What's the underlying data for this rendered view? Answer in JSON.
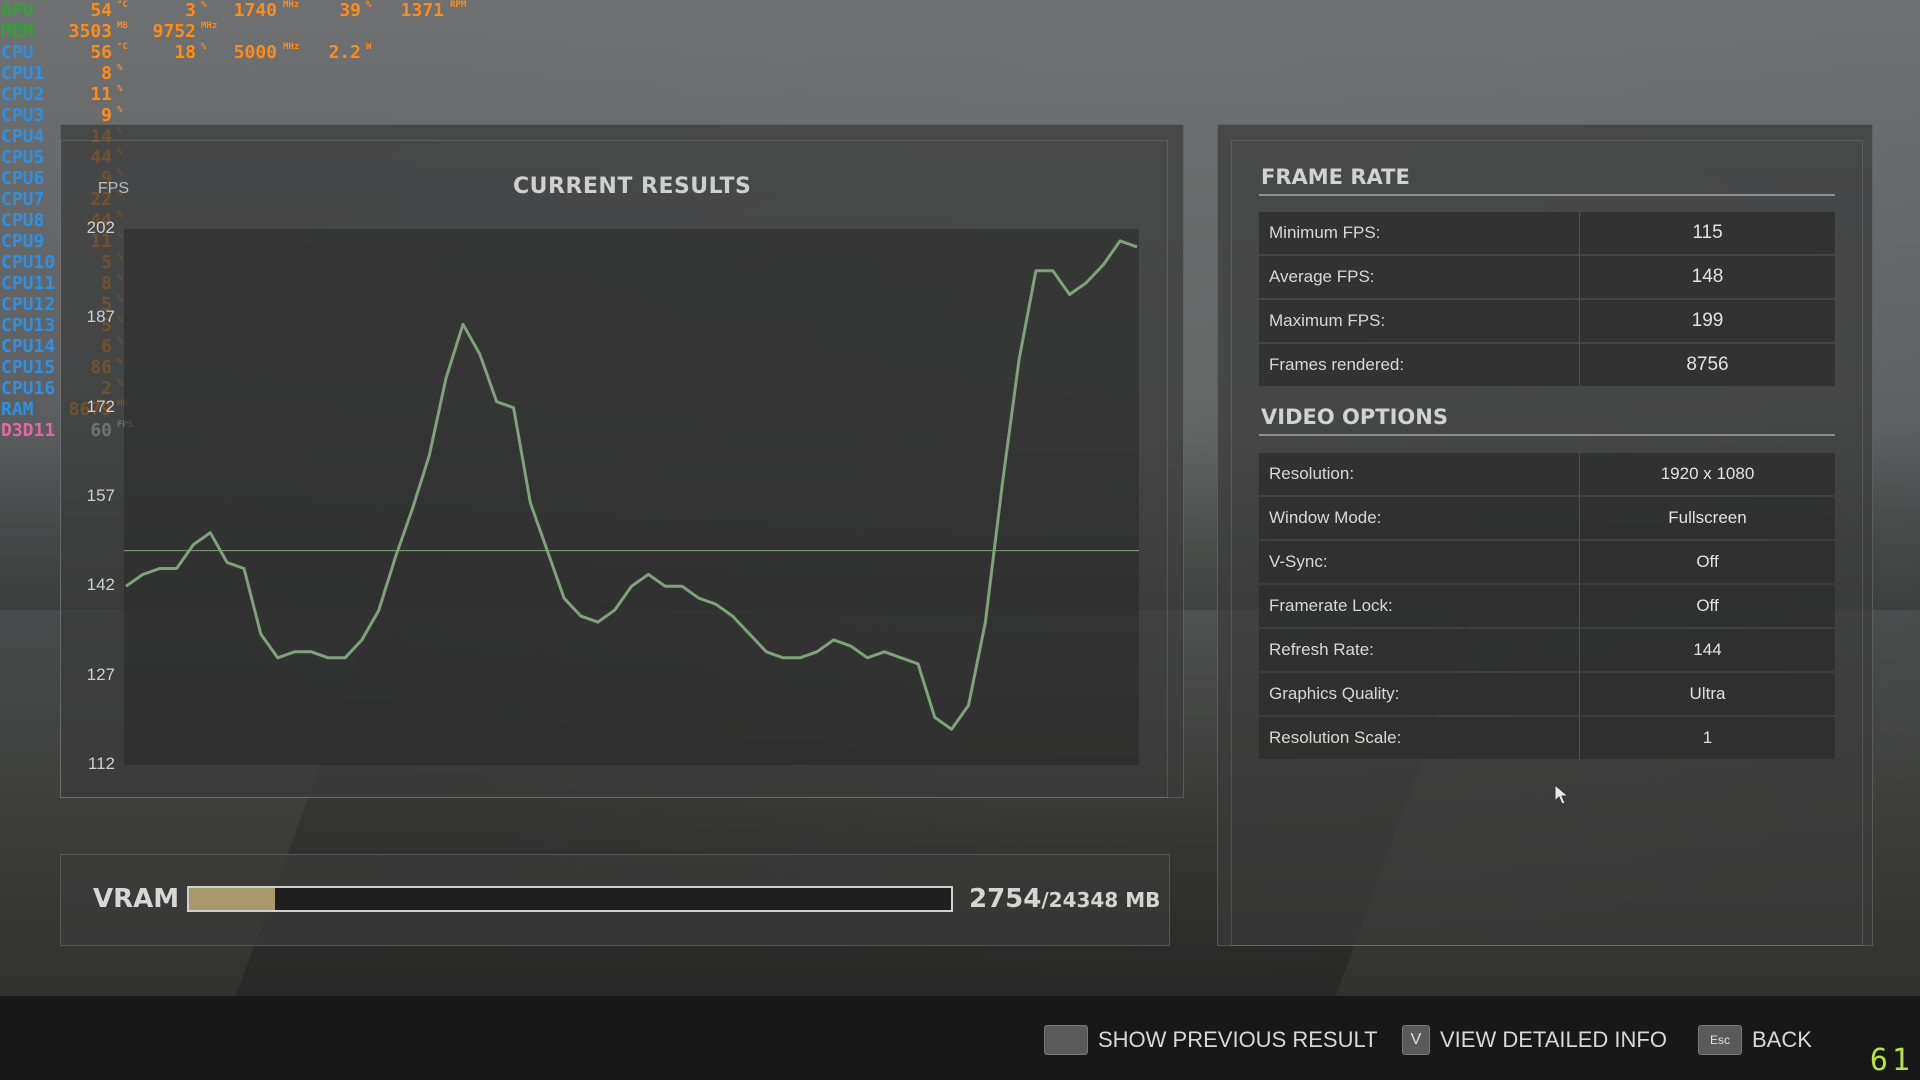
{
  "osd": {
    "rows": [
      {
        "label": "GPU",
        "label_color": "#2ea52e",
        "cells": [
          [
            "54",
            "°C"
          ],
          [
            "3",
            "%"
          ],
          [
            "1740",
            "MHz"
          ],
          [
            "39",
            "%"
          ],
          [
            "1371",
            "RPM"
          ]
        ]
      },
      {
        "label": "MEM",
        "label_color": "#2ea52e",
        "cells": [
          [
            "3503",
            "MB"
          ],
          [
            "9752",
            "MHz"
          ]
        ]
      },
      {
        "label": "CPU",
        "label_color": "#2f8fe0",
        "cells": [
          [
            "56",
            "°C"
          ],
          [
            "18",
            "%"
          ],
          [
            "5000",
            "MHz"
          ],
          [
            "2.2",
            "W"
          ]
        ]
      },
      {
        "label": "CPU1",
        "label_color": "#2f8fe0",
        "cells": [
          [
            "8",
            "%"
          ]
        ]
      },
      {
        "label": "CPU2",
        "label_color": "#2f8fe0",
        "cells": [
          [
            "11",
            "%"
          ]
        ]
      },
      {
        "label": "CPU3",
        "label_color": "#2f8fe0",
        "cells": [
          [
            "9",
            "%"
          ]
        ]
      },
      {
        "label": "CPU4",
        "label_color": "#2f8fe0",
        "cells": [
          [
            "14",
            "%"
          ]
        ]
      },
      {
        "label": "CPU5",
        "label_color": "#2f8fe0",
        "cells": [
          [
            "44",
            "%"
          ]
        ]
      },
      {
        "label": "CPU6",
        "label_color": "#2f8fe0",
        "cells": [
          [
            "9",
            "%"
          ]
        ]
      },
      {
        "label": "CPU7",
        "label_color": "#2f8fe0",
        "cells": [
          [
            "22",
            "%"
          ]
        ]
      },
      {
        "label": "CPU8",
        "label_color": "#2f8fe0",
        "cells": [
          [
            "44",
            "%"
          ]
        ]
      },
      {
        "label": "CPU9",
        "label_color": "#2f8fe0",
        "cells": [
          [
            "11",
            "%"
          ]
        ]
      },
      {
        "label": "CPU10",
        "label_color": "#2f8fe0",
        "cells": [
          [
            "5",
            "%"
          ]
        ]
      },
      {
        "label": "CPU11",
        "label_color": "#2f8fe0",
        "cells": [
          [
            "8",
            "%"
          ]
        ]
      },
      {
        "label": "CPU12",
        "label_color": "#2f8fe0",
        "cells": [
          [
            "5",
            "%"
          ]
        ]
      },
      {
        "label": "CPU13",
        "label_color": "#2f8fe0",
        "cells": [
          [
            "5",
            "%"
          ]
        ]
      },
      {
        "label": "CPU14",
        "label_color": "#2f8fe0",
        "cells": [
          [
            "6",
            "%"
          ]
        ]
      },
      {
        "label": "CPU15",
        "label_color": "#2f8fe0",
        "cells": [
          [
            "86",
            "%"
          ]
        ]
      },
      {
        "label": "CPU16",
        "label_color": "#2f8fe0",
        "cells": [
          [
            "2",
            "%"
          ]
        ]
      },
      {
        "label": "RAM",
        "label_color": "#2f8fe0",
        "cells": [
          [
            "8679",
            "MB"
          ]
        ]
      },
      {
        "label": "D3D11",
        "label_color": "#e06aa0",
        "cells": [
          [
            "60",
            "FPS"
          ]
        ]
      }
    ]
  },
  "results": {
    "title": "CURRENT RESULTS",
    "y_axis_label": "FPS"
  },
  "chart_data": {
    "type": "line",
    "title": "CURRENT RESULTS",
    "ylabel": "FPS",
    "ylim": [
      112,
      202
    ],
    "ticks": [
      112,
      127,
      142,
      157,
      172,
      187,
      202
    ],
    "tick_labels": [
      "112",
      "127",
      "142",
      "157",
      "172",
      "187",
      "202"
    ],
    "reference_line": 148,
    "series": [
      {
        "color": "#7fa27a",
        "x": [
          0,
          1,
          2,
          3,
          4,
          5,
          6,
          7,
          8,
          9,
          10,
          11,
          12,
          13,
          14,
          15,
          16,
          17,
          18,
          19,
          20,
          21,
          22,
          23,
          24,
          25,
          26,
          27,
          28,
          29,
          30,
          31,
          32,
          33,
          34,
          35,
          36,
          37,
          38,
          39,
          40,
          41,
          42,
          43,
          44,
          45,
          46,
          47,
          48,
          49,
          50,
          51,
          52,
          53,
          54,
          55,
          56,
          57,
          58,
          59,
          60
        ],
        "values": [
          142,
          144,
          145,
          145,
          149,
          151,
          146,
          145,
          134,
          130,
          131,
          131,
          130,
          130,
          133,
          138,
          147,
          155,
          164,
          177,
          186,
          181,
          173,
          172,
          156,
          148,
          140,
          137,
          136,
          138,
          142,
          144,
          142,
          142,
          140,
          139,
          137,
          134,
          131,
          130,
          130,
          131,
          133,
          132,
          130,
          131,
          130,
          129,
          120,
          118,
          122,
          136,
          159,
          180,
          195,
          195,
          191,
          193,
          196,
          200,
          199
        ]
      }
    ]
  },
  "vram": {
    "label": "VRAM",
    "used": "2754",
    "total": "/24348 MB",
    "fraction": 0.1131
  },
  "frame_rate": {
    "title": "FRAME RATE",
    "rows": [
      {
        "key": "Minimum FPS:",
        "value": "115"
      },
      {
        "key": "Average FPS:",
        "value": "148"
      },
      {
        "key": "Maximum FPS:",
        "value": "199"
      },
      {
        "key": "Frames rendered:",
        "value": "8756"
      }
    ]
  },
  "video_options": {
    "title": "VIDEO OPTIONS",
    "rows": [
      {
        "key": "Resolution:",
        "value": "1920 x 1080"
      },
      {
        "key": "Window Mode:",
        "value": "Fullscreen"
      },
      {
        "key": "V-Sync:",
        "value": "Off"
      },
      {
        "key": "Framerate Lock:",
        "value": "Off"
      },
      {
        "key": "Refresh Rate:",
        "value": "144"
      },
      {
        "key": "Graphics Quality:",
        "value": "Ultra"
      },
      {
        "key": "Resolution Scale:",
        "value": "1"
      }
    ]
  },
  "bottom": {
    "show_previous": {
      "key": "",
      "label": "SHOW PREVIOUS RESULT"
    },
    "view_detailed": {
      "key": "V",
      "label": "VIEW DETAILED INFO"
    },
    "back": {
      "key": "Esc",
      "label": "BACK"
    }
  },
  "corner_fps": "61"
}
